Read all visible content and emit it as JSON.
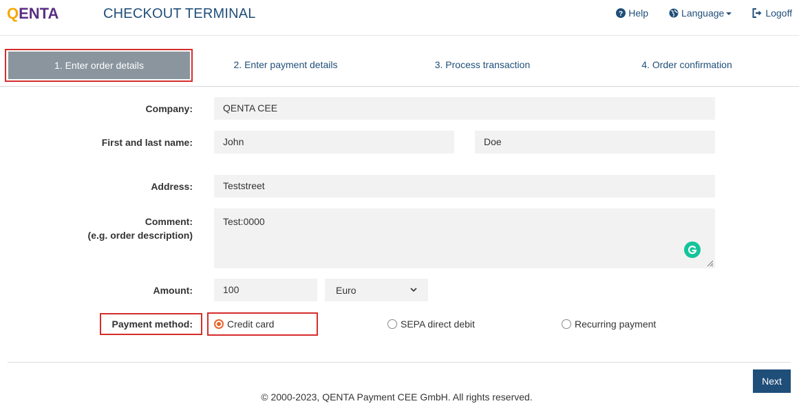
{
  "header": {
    "logo_first": "Q",
    "logo_rest": "ENTA",
    "title": "CHECKOUT TERMINAL",
    "nav": {
      "help": "Help",
      "language": "Language",
      "logoff": "Logoff"
    }
  },
  "steps": [
    {
      "label": "1. Enter order details"
    },
    {
      "label": "2. Enter payment details"
    },
    {
      "label": "3. Process transaction"
    },
    {
      "label": "4. Order confirmation"
    }
  ],
  "form": {
    "company_label": "Company:",
    "company_value": "QENTA CEE",
    "name_label": "First and last name:",
    "first_name": "John",
    "last_name": "Doe",
    "address_label": "Address:",
    "address_value": "Teststreet",
    "comment_label": "Comment:",
    "comment_sublabel": "(e.g. order description)",
    "comment_value": "Test:0000",
    "amount_label": "Amount:",
    "amount_value": "100",
    "currency_selected": "Euro",
    "payment_label": "Payment method:",
    "payment_options": [
      {
        "label": "Credit card",
        "checked": true
      },
      {
        "label": "SEPA direct debit",
        "checked": false
      },
      {
        "label": "Recurring payment",
        "checked": false
      }
    ]
  },
  "actions": {
    "next_label": "Next"
  },
  "footer": {
    "copyright": "© 2000-2023, QENTA Payment CEE GmbH. All rights reserved."
  },
  "colors": {
    "primary": "#1f4e79",
    "highlight_outline": "#d62b2b",
    "active_step_bg": "#8a959e",
    "radio_accent": "#e8642c",
    "logo_q": "#f5a800",
    "logo_text": "#5a2d82"
  }
}
